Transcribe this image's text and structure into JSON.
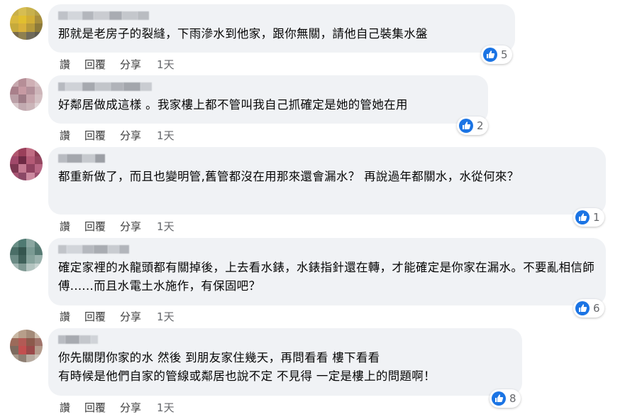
{
  "actions": {
    "like": "讚",
    "reply": "回覆",
    "share": "分享"
  },
  "comments": [
    {
      "text": "那就是老房子的裂縫，下雨滲水到他家，跟你無關，請他自己裝集水盤",
      "time": "1天",
      "likes": "5"
    },
    {
      "text": "好鄰居做成這樣 。我家樓上都不管叫我自己抓確定是她的管她在用",
      "time": "1天",
      "likes": "2"
    },
    {
      "text": "都重新做了，而且也變明管,舊管都沒在用那來還會漏水？ 再說過年都關水，水從何來？",
      "time": "1天",
      "likes": "1"
    },
    {
      "text": "確定家裡的水龍頭都有關掉後，上去看水錶，水錶指針還在轉，才能確定是你家在漏水。不要亂相信師傅......而且水電土水施作，有保固吧？",
      "time": "1天",
      "likes": "6"
    },
    {
      "text": "你先關閉你家的水 然後 到朋友家住幾天，再問看看 樓下看看\n有時候是他們自家的管線或鄰居也說不定 不見得 一定是樓上的問題啊！",
      "time": "1天",
      "likes": "8"
    }
  ],
  "colors": {
    "like_blue": "#1b74e4",
    "bubble_bg": "#f0f2f5",
    "action_text": "#3b3b3b"
  }
}
